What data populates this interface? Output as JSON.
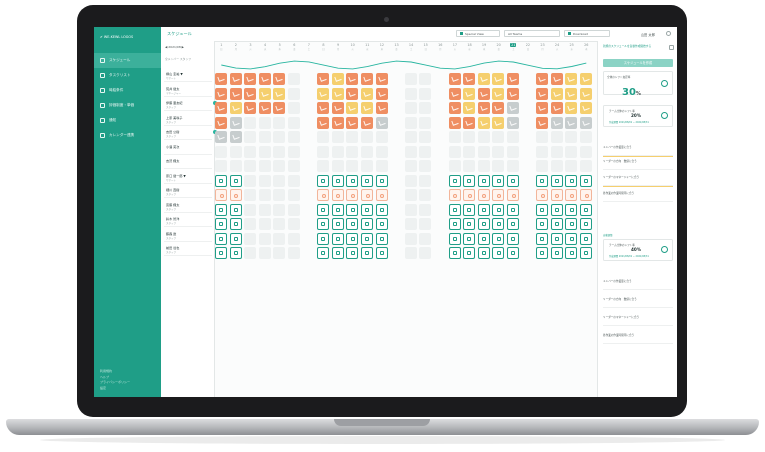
{
  "app": {
    "logo": "✔ WE-KEWL LOGOS",
    "page_title": "スケジュール",
    "accent_color": "#1f9e87"
  },
  "sidebar": {
    "items": [
      {
        "label": "スケジュール",
        "icon": "calendar-icon",
        "active": true
      },
      {
        "label": "タスクリスト",
        "icon": "list-icon"
      },
      {
        "label": "時給条件",
        "icon": "yen-icon"
      },
      {
        "label": "評価制度・単価",
        "icon": "chart-icon"
      },
      {
        "label": "通知",
        "icon": "bell-icon"
      },
      {
        "label": "カレンダー連携",
        "icon": "link-icon"
      }
    ],
    "footer": [
      "利用規約",
      "ヘルプ",
      "プライバシーポリシー",
      "設定"
    ]
  },
  "topbar": {
    "special_view": "Special View",
    "team_select": "All Teams",
    "save_label": "Download",
    "user_name": "山田 太郎"
  },
  "people_panel": {
    "toolbar": "◀ 2021/08 ▶",
    "filter_note": "全メンバー スタッフ",
    "people": [
      {
        "name": "横山 圭祐 ▼",
        "sub": "サポート"
      },
      {
        "name": "荒井 健太",
        "sub": "マネージャー"
      },
      {
        "name": "伊藤 亜友紀",
        "sub": "スタッフ"
      },
      {
        "name": "上原 美咲子",
        "sub": "スタッフ"
      },
      {
        "name": "吉田 公樹",
        "sub": "スタッフ"
      },
      {
        "name": "小澤 英次",
        "sub": ""
      },
      {
        "name": "吉沢 翔太",
        "sub": ""
      },
      {
        "name": "原口 健一郎 ▼",
        "sub": "サポート"
      },
      {
        "name": "細川 直樹",
        "sub": "スタッフ"
      },
      {
        "name": "斎藤 翔太",
        "sub": "スタッフ"
      },
      {
        "name": "鈴木 智洋",
        "sub": "スタッフ"
      },
      {
        "name": "藤森 遼",
        "sub": "スタッフ"
      },
      {
        "name": "前田 達也",
        "sub": "スタッフ"
      }
    ]
  },
  "calendar": {
    "days": [
      {
        "d": "1",
        "w": "日"
      },
      {
        "d": "2",
        "w": "月"
      },
      {
        "d": "3",
        "w": "火"
      },
      {
        "d": "4",
        "w": "水"
      },
      {
        "d": "5",
        "w": "木"
      },
      {
        "d": "6",
        "w": "金"
      },
      {
        "d": "7",
        "w": "土"
      },
      {
        "d": "8",
        "w": "日"
      },
      {
        "d": "9",
        "w": "月"
      },
      {
        "d": "10",
        "w": "火"
      },
      {
        "d": "11",
        "w": "水"
      },
      {
        "d": "12",
        "w": "木"
      },
      {
        "d": "13",
        "w": "金"
      },
      {
        "d": "14",
        "w": "土"
      },
      {
        "d": "15",
        "w": "日"
      },
      {
        "d": "16",
        "w": "月"
      },
      {
        "d": "17",
        "w": "火"
      },
      {
        "d": "18",
        "w": "水"
      },
      {
        "d": "19",
        "w": "木"
      },
      {
        "d": "20",
        "w": "金"
      },
      {
        "d": "21",
        "w": "土"
      },
      {
        "d": "22",
        "w": "日"
      },
      {
        "d": "23",
        "w": "月"
      },
      {
        "d": "24",
        "w": "火"
      },
      {
        "d": "25",
        "w": "水"
      },
      {
        "d": "26",
        "w": "木"
      }
    ],
    "today_index": 20,
    "rows": [
      "oooooe.oyooo.ee.ooyyo.ooyy",
      "oooyye.yyoyo.ee.oyoyo.oyyy",
      "oyoooe.ooyyo.ee.oyoog.ooyy",
      "ogeeee.oooog.ee.ooyyg.oggg",
      "ggeeee.eeeee.ee.eeeee.eeee",
      "eeeeee.eeeee.ee.eeeee.eeee",
      "eeeeee.eeeee.ee.eeeee.eeee",
      "tteeee.ttttt.ee.ttttt.tttt",
      "ppeeee.ppppp.ee.ppppp.pppp",
      "tteeee.ttttt.ee.ttttt.tttt",
      "tteeee.ttttt.ee.ttttt.tttt",
      "tteeee.ttttt.ee.ttttt.tttt",
      "tteeee.ttttt.ee.ttttt.tttt"
    ]
  },
  "right_panel": {
    "header": "新規のスケジュールを自動作成開始する",
    "create_button": "スケジュールを作成",
    "summary_label": "全体のシフト充足率",
    "summary_value": "30",
    "summary_unit": "%",
    "card1_title": "チーム全体のシフト率",
    "card1_value": "20%",
    "card1_sub": "作成期間 2021/08/01 ~ 2021/08/31",
    "tasks_a": [
      "メンバーの作業量に合う",
      "リーダーの方向　数値に合う",
      "リーダーのマネージャーに合う",
      "各作業の作業時間帯に合う"
    ],
    "section_label": "自動調整",
    "card2_title": "チーム全体のシフト率",
    "card2_value": "40%",
    "card2_sub": "作成期間 2021/08/01 ~ 2021/08/31",
    "tasks_b": [
      "メンバーの作業量に合う",
      "リーダーの方向　数値に合う",
      "リーダーのマネージャーに合う",
      "各作業の作業時間帯に合う"
    ]
  }
}
